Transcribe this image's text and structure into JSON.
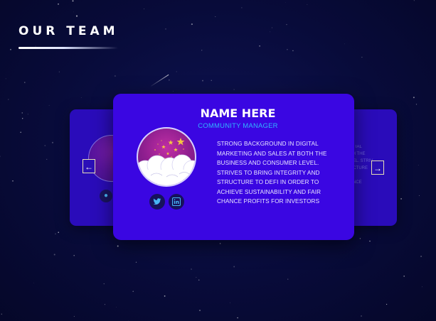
{
  "section": {
    "title": "OUR TEAM"
  },
  "active_member": {
    "name": "NAME HERE",
    "role": "COMMUNITY MANAGER",
    "bio": "STRONG BACKGROUND IN DIGITAL MARKETING AND SALES AT BOTH THE BUSINESS AND CONSUMER LEVEL. STRIVES TO BRING INTEGRITY AND STRUCTURE TO DEFI IN ORDER TO ACHIEVE SUSTAINABILITY AND FAIR CHANCE PROFITS FOR INVESTORS",
    "socials": [
      {
        "name": "twitter",
        "icon": "twitter-icon"
      },
      {
        "name": "linkedin",
        "icon": "linkedin-icon"
      }
    ]
  },
  "back_card": {
    "bio_fragments": [
      "GITAL",
      "TH THE",
      "VEL. STRIV",
      "UCTURE",
      "",
      "ANCE"
    ]
  },
  "navigation": {
    "prev_icon": "arrow-left-icon",
    "next_icon": "arrow-right-icon",
    "prev_glyph": "←",
    "next_glyph": "→"
  },
  "colors": {
    "background": "#080b3a",
    "card_front": "#3a06e2",
    "card_back": "#2a0cba",
    "role": "#30b4ff",
    "icon_blue": "#47b4f5",
    "social_bg": "#16125c",
    "avatar_magenta": "#a6249a",
    "star_gold": "#f4c542"
  }
}
